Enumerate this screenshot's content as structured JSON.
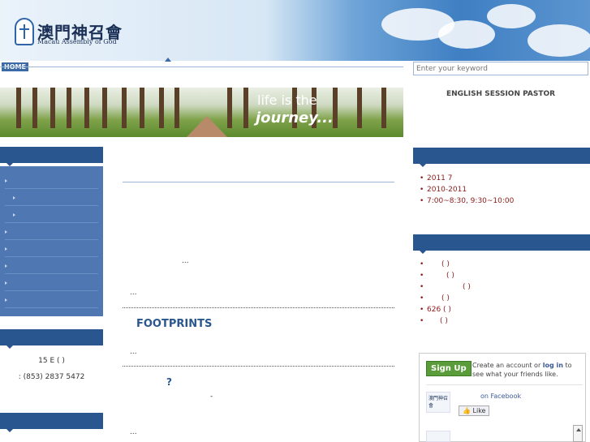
{
  "header": {
    "title_zh": "澳門神召會",
    "title_en": "Macau Assembly of God"
  },
  "nav": {
    "home": "HOME"
  },
  "search": {
    "placeholder": "Enter your keyword"
  },
  "banner": {
    "line1": "life is the",
    "line2": "journey..."
  },
  "right": {
    "pastor": "ENGLISH SESSION PASTOR",
    "list1": [
      "2011 7",
      "2010-2011",
      "7:00~8:30,    9:30~10:00"
    ],
    "list2": [
      "(   )",
      "(   )",
      "(   )",
      "(   )",
      "626                (   )",
      "(   )"
    ]
  },
  "left": {
    "address": "15 E      (     )",
    "phone": ": (853) 2837 5472"
  },
  "main": {
    "ellipsis": "...",
    "footprints": "FOOTPRINTS",
    "qmark": "?",
    "dash": "-"
  },
  "facebook": {
    "signup": "Sign Up",
    "text_a": "Create an account or",
    "login": "log in",
    "text_b": "to see what your friends like.",
    "page_label": "on Facebook",
    "like": "Like",
    "logo_text": "澳門神召會"
  },
  "colors": {
    "header_blue": "#2a5690",
    "menu_blue": "#4f78b2",
    "link_red": "#8a1a1a",
    "fb_green": "#5b9c3a"
  }
}
